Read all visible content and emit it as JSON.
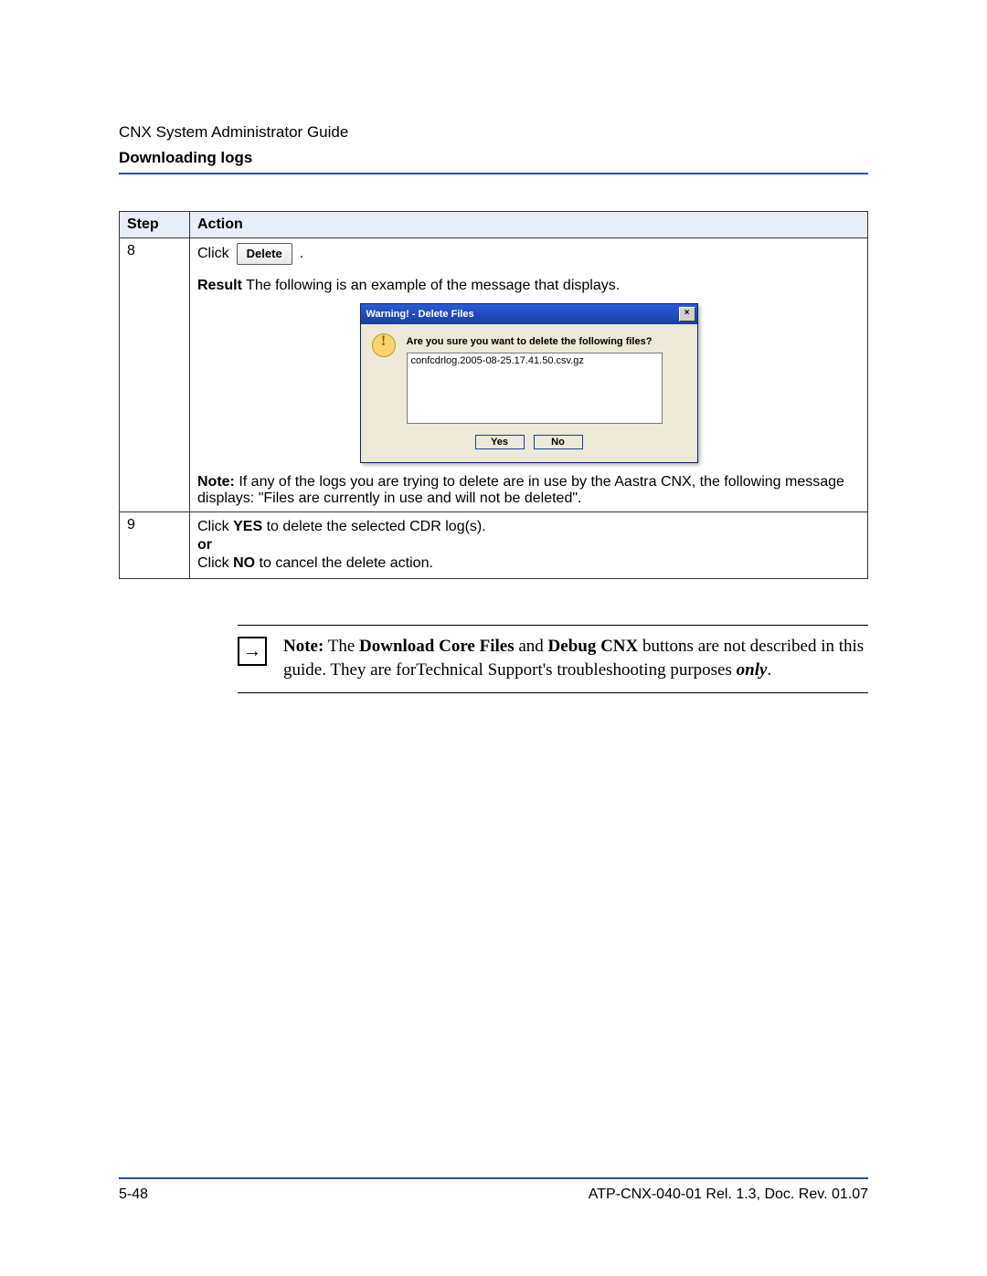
{
  "header": {
    "guide_title": "CNX System Administrator Guide",
    "section_title": "Downloading logs"
  },
  "table": {
    "headers": {
      "step": "Step",
      "action": "Action"
    },
    "rows": {
      "r8": {
        "step": "8",
        "click_label": "Click",
        "delete_button_label": "Delete",
        "trailing_period": ".",
        "result_label": "Result",
        "result_text": " The following is an example of the message that displays.",
        "note_label": "Note:",
        "note_text": " If any of the logs you are trying to delete are in use by the Aastra CNX, the following message displays: \"Files are currently in use and will not be deleted\"."
      },
      "r9": {
        "step": "9",
        "line1_pre": "Click ",
        "line1_bold": "YES",
        "line1_post": " to delete the selected CDR log(s).",
        "or_label": "or",
        "line2_pre": "Click ",
        "line2_bold": "NO",
        "line2_post": " to cancel the delete action."
      }
    }
  },
  "dialog": {
    "title": "Warning! - Delete Files",
    "close_glyph": "×",
    "question": "Are you sure you want to delete the following files?",
    "file_list": "confcdrlog.2005-08-25.17.41.50.csv.gz",
    "yes_label": "Yes",
    "no_label": "No"
  },
  "note_block": {
    "arrow_glyph": "→",
    "label": "Note:",
    "t1": " The ",
    "b1": "Download Core Files",
    "t2": " and ",
    "b2": "Debug CNX",
    "t3": " buttons are not described in this guide. They are forTechnical Support's troubleshooting purposes ",
    "em": "only",
    "t4": "."
  },
  "footer": {
    "page_number": "5-48",
    "doc_id": "ATP-CNX-040-01 Rel. 1.3, Doc. Rev. 01.07"
  }
}
